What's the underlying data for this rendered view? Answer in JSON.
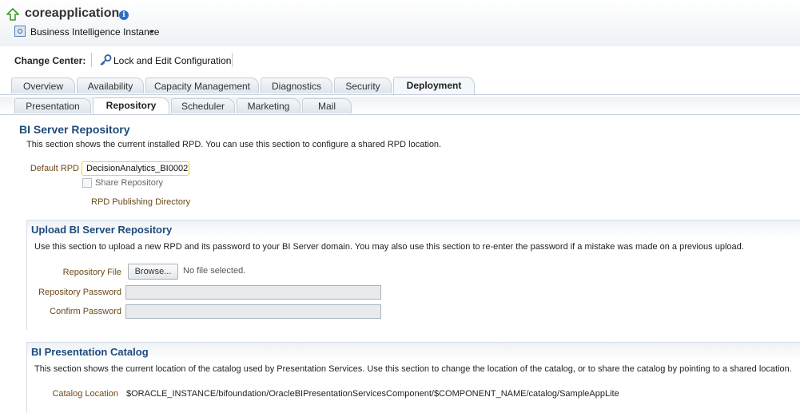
{
  "header": {
    "title": "coreapplication",
    "instance_menu": "Business Intelligence Instance",
    "info_glyph": "i"
  },
  "change_center": {
    "label": "Change Center:",
    "lock_link": "Lock and Edit Configuration"
  },
  "tabs": [
    "Overview",
    "Availability",
    "Capacity Management",
    "Diagnostics",
    "Security",
    "Deployment"
  ],
  "selected_tab": "Deployment",
  "subtabs": [
    "Presentation",
    "Repository",
    "Scheduler",
    "Marketing",
    "Mail"
  ],
  "selected_subtab": "Repository",
  "bi_server_repository": {
    "heading": "BI Server Repository",
    "description": "This section shows the current installed RPD. You can use this section to configure a shared RPD location.",
    "default_rpd_label": "Default RPD",
    "default_rpd_value": "DecisionAnalytics_BI0002",
    "share_label": "Share Repository",
    "publishing_dir_label": "RPD Publishing Directory"
  },
  "upload": {
    "heading": "Upload BI Server Repository",
    "description": "Use this section to upload a new RPD and its password to your BI Server domain. You may also use this section to re-enter the password if a mistake was made on a previous upload.",
    "file_label": "Repository File",
    "browse_label": "Browse...",
    "no_file_text": "No file selected.",
    "password_label": "Repository Password",
    "confirm_label": "Confirm Password"
  },
  "catalog": {
    "heading": "BI Presentation Catalog",
    "description": "This section shows the current location of the catalog used by Presentation Services. Use this section to change the location of the catalog, or to share the catalog by pointing to a shared location.",
    "location_label": "Catalog Location",
    "location_value": "$ORACLE_INSTANCE/bifoundation/OracleBIPresentationServicesComponent/$COMPONENT_NAME/catalog/SampleAppLite"
  },
  "icons": {
    "up": "up-arrow-icon",
    "info": "info-icon",
    "instance": "instance-icon",
    "key": "key-icon"
  },
  "colors": {
    "heading": "#1f4b7a",
    "label": "#6b4a1a",
    "info": "#2d6ec9",
    "up_arrow": "#3d9a2a"
  }
}
